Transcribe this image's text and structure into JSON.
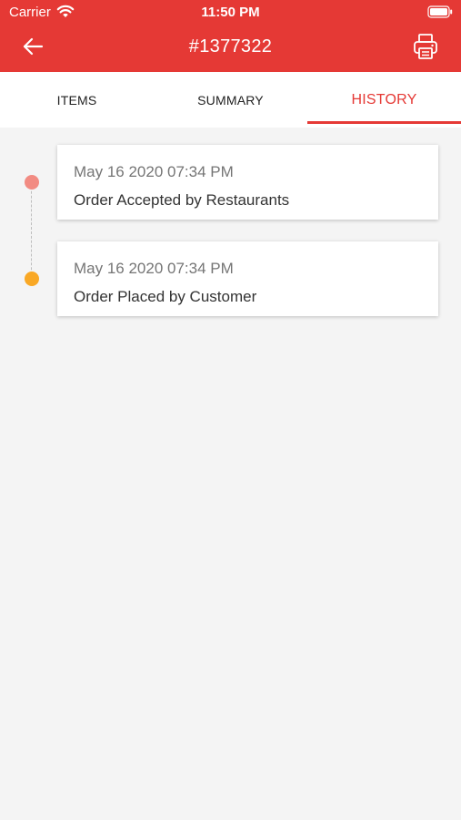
{
  "status_bar": {
    "carrier": "Carrier",
    "time": "11:50 PM",
    "icons": [
      "wifi-icon",
      "battery-icon"
    ]
  },
  "nav": {
    "title": "#1377322",
    "back_icon": "arrow-left-icon",
    "print_icon": "printer-icon"
  },
  "tabs": [
    {
      "label": "ITEMS",
      "active": false
    },
    {
      "label": "SUMMARY",
      "active": false
    },
    {
      "label": "HISTORY",
      "active": true
    }
  ],
  "history": [
    {
      "date": "May 16 2020 07:34 PM",
      "event": "Order Accepted by Restaurants",
      "dot_color": "#f28b82"
    },
    {
      "date": "May 16 2020 07:34 PM",
      "event": "Order Placed by Customer",
      "dot_color": "#f9a825"
    }
  ],
  "colors": {
    "primary": "#e53935",
    "background": "#f4f4f4"
  }
}
